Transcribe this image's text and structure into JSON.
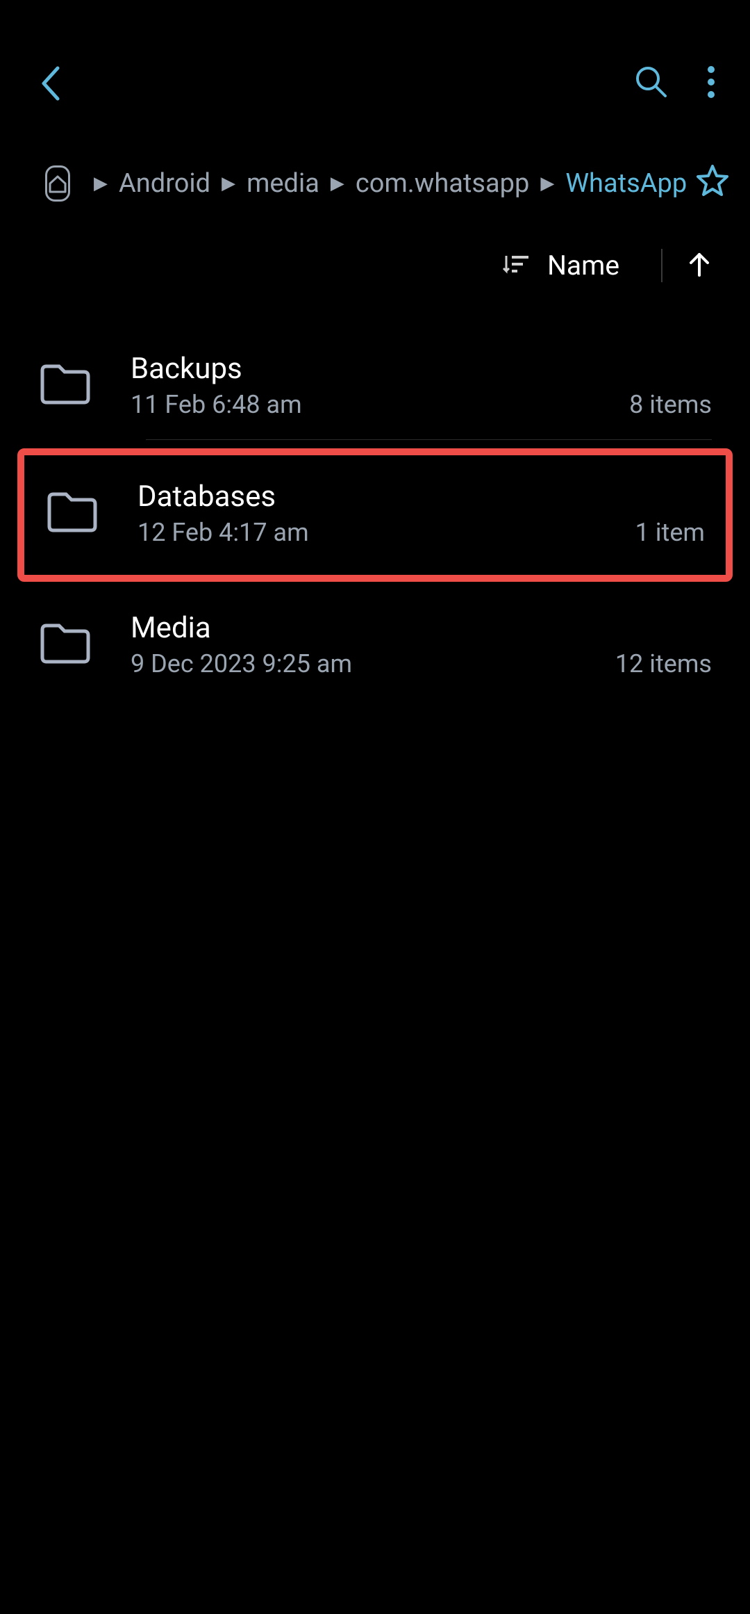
{
  "breadcrumb": {
    "items": [
      "Android",
      "media",
      "com.whatsapp",
      "WhatsApp"
    ],
    "active_index": 3
  },
  "sort": {
    "label": "Name"
  },
  "folders": [
    {
      "name": "Backups",
      "date": "11 Feb 6:48 am",
      "count": "8 items",
      "highlighted": false
    },
    {
      "name": "Databases",
      "date": "12 Feb 4:17 am",
      "count": "1 item",
      "highlighted": true
    },
    {
      "name": "Media",
      "date": "9 Dec 2023 9:25 am",
      "count": "12 items",
      "highlighted": false
    }
  ]
}
